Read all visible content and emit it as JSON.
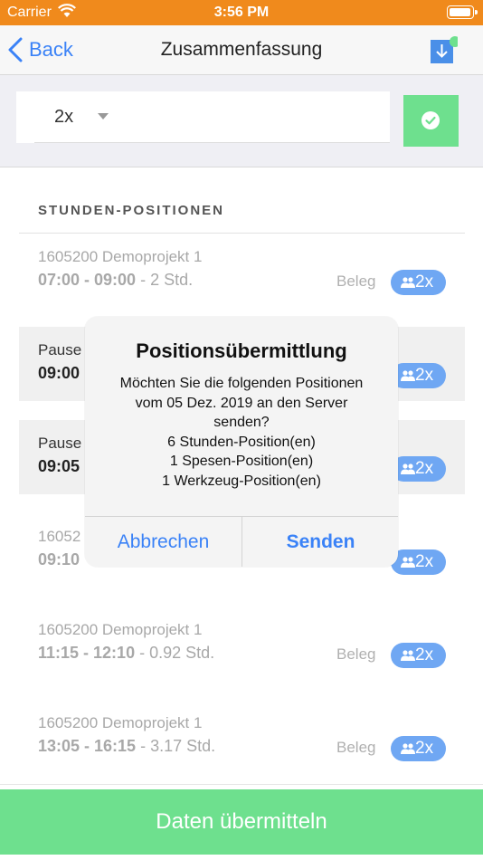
{
  "status_bar": {
    "carrier": "Carrier",
    "time": "3:56 PM"
  },
  "nav": {
    "back_label": "Back",
    "title": "Zusammenfassung"
  },
  "filter": {
    "selected_value": "2x"
  },
  "list": {
    "section_header": "STUNDEN-POSITIONEN",
    "rows": [
      {
        "line1": "1605200 Demoprojekt 1",
        "time": "07:00 - 09:00",
        "duration": " - 2 Std.",
        "beleg": "Beleg",
        "badge": "2x"
      },
      {
        "line1": "Pause",
        "time": "09:00",
        "duration": "",
        "beleg": "",
        "badge": "2x"
      },
      {
        "line1": "Pause",
        "time": "09:05",
        "duration": "",
        "beleg": "",
        "badge": "2x"
      },
      {
        "line1": "16052",
        "time": "09:10",
        "duration": "",
        "beleg": "",
        "badge": "2x"
      },
      {
        "line1": "1605200 Demoprojekt 1",
        "time": "11:15 - 12:10",
        "duration": " - 0.92 Std.",
        "beleg": "Beleg",
        "badge": "2x"
      },
      {
        "line1": "1605200 Demoprojekt 1",
        "time": "13:05 - 16:15",
        "duration": " - 3.17 Std.",
        "beleg": "Beleg",
        "badge": "2x"
      }
    ]
  },
  "alert": {
    "title": "Positionsübermittlung",
    "message_lines": [
      "Möchten Sie die folgenden Positionen",
      "vom 05 Dez. 2019 an den Server",
      "senden?",
      "6 Stunden-Position(en)",
      "1 Spesen-Position(en)",
      "1 Werkzeug-Position(en)"
    ],
    "cancel_label": "Abbrechen",
    "send_label": "Senden"
  },
  "bottom": {
    "submit_label": "Daten übermitteln"
  },
  "colors": {
    "status_bar": "#f08a1c",
    "accent_blue": "#3a82f7",
    "green": "#6ee08e",
    "badge_blue": "#6fa7f3"
  },
  "icons": [
    "wifi-icon",
    "battery-icon",
    "chevron-left-icon",
    "download-icon",
    "check-circle-icon",
    "people-icon"
  ]
}
